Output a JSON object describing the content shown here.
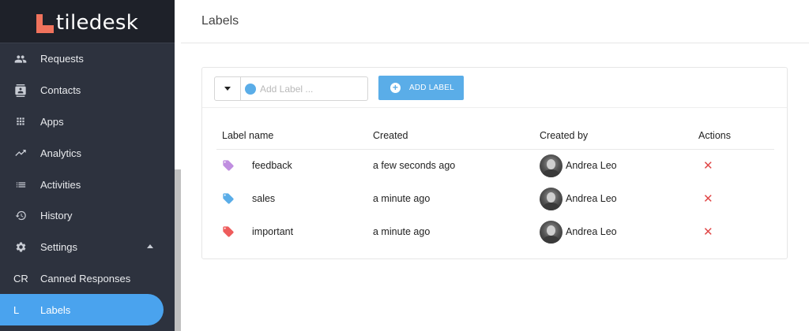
{
  "app": {
    "logo_text": "tiledesk",
    "brand_color": "#f0725c",
    "accent_color": "#4aa3ee"
  },
  "sidebar": {
    "items": [
      {
        "label": "Requests",
        "icon": "people-icon"
      },
      {
        "label": "Contacts",
        "icon": "contact-card-icon"
      },
      {
        "label": "Apps",
        "icon": "grid-icon"
      },
      {
        "label": "Analytics",
        "icon": "trend-icon"
      },
      {
        "label": "Activities",
        "icon": "list-icon"
      },
      {
        "label": "History",
        "icon": "history-icon"
      },
      {
        "label": "Settings",
        "icon": "gear-icon",
        "expanded": true
      },
      {
        "label": "Canned Responses",
        "abbr": "CR"
      },
      {
        "label": "Labels",
        "abbr": "L",
        "active": true
      }
    ]
  },
  "header": {
    "title": "Labels"
  },
  "toolbar": {
    "input_placeholder": "Add Label ...",
    "selected_color": "#5aade8",
    "add_button_label": "ADD LABEL"
  },
  "table": {
    "columns": [
      "Label name",
      "Created",
      "Created by",
      "Actions"
    ],
    "rows": [
      {
        "name": "feedback",
        "color": "#c08ee0",
        "created": "a few seconds ago",
        "created_by": "Andrea Leo"
      },
      {
        "name": "sales",
        "color": "#5aade8",
        "created": "a minute ago",
        "created_by": "Andrea Leo"
      },
      {
        "name": "important",
        "color": "#ee5c5c",
        "created": "a minute ago",
        "created_by": "Andrea Leo"
      }
    ]
  }
}
